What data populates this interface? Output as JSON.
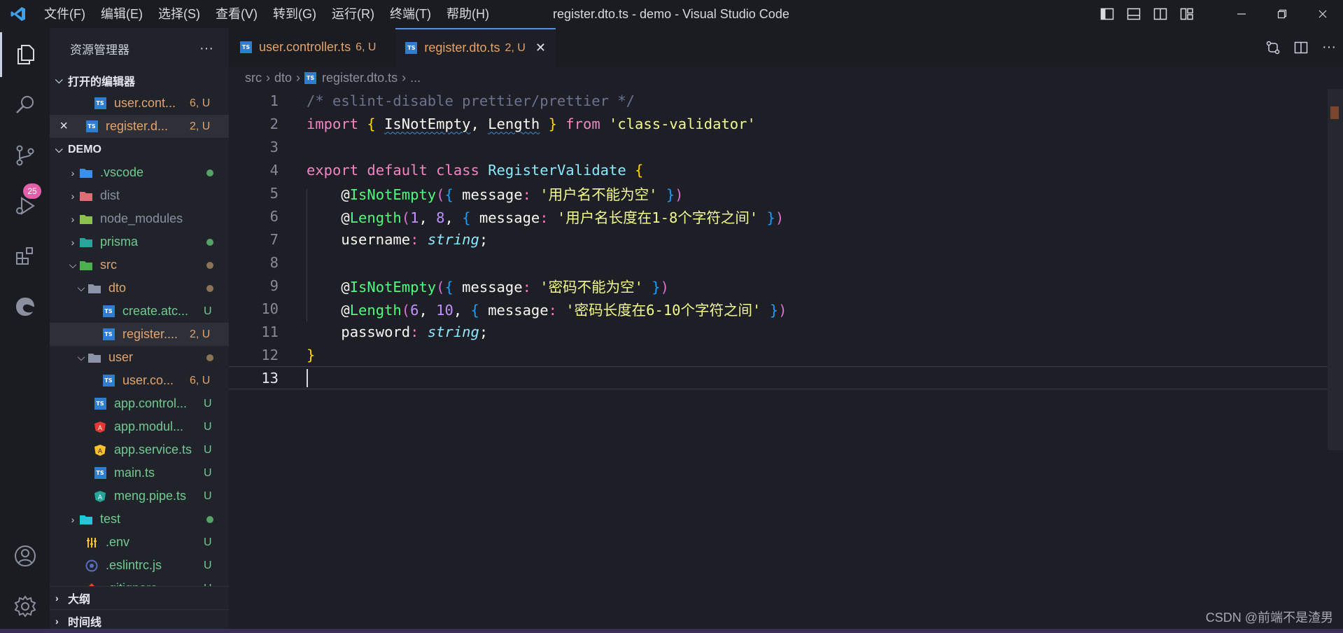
{
  "window": {
    "title": "register.dto.ts - demo - Visual Studio Code",
    "menu": [
      "文件(F)",
      "编辑(E)",
      "选择(S)",
      "查看(V)",
      "转到(G)",
      "运行(R)",
      "终端(T)",
      "帮助(H)"
    ]
  },
  "activity": {
    "scm_badge": "25"
  },
  "sidebar": {
    "title": "资源管理器",
    "more": "···",
    "open_editors_title": "打开的编辑器",
    "open_editors": [
      {
        "name": "user.cont...",
        "status": "6, U"
      },
      {
        "name": "register.d...",
        "status": "2, U"
      }
    ],
    "project_title": "DEMO",
    "tree": [
      {
        "name": ".vscode",
        "status": "",
        "kind": "folder"
      },
      {
        "name": "dist",
        "status": "",
        "kind": "folder"
      },
      {
        "name": "node_modules",
        "status": "",
        "kind": "folder"
      },
      {
        "name": "prisma",
        "status": "",
        "kind": "folder"
      },
      {
        "name": "src",
        "status": "",
        "kind": "folder"
      },
      {
        "name": "dto",
        "status": "",
        "kind": "folder"
      },
      {
        "name": "create.atc...",
        "status": "U",
        "kind": "ts"
      },
      {
        "name": "register....",
        "status": "2, U",
        "kind": "ts"
      },
      {
        "name": "user",
        "status": "",
        "kind": "folder"
      },
      {
        "name": "user.co...",
        "status": "6, U",
        "kind": "ts"
      },
      {
        "name": "app.control...",
        "status": "U",
        "kind": "ts"
      },
      {
        "name": "app.modul...",
        "status": "U",
        "kind": "angular"
      },
      {
        "name": "app.service.ts",
        "status": "U",
        "kind": "angular"
      },
      {
        "name": "main.ts",
        "status": "U",
        "kind": "ts"
      },
      {
        "name": "meng.pipe.ts",
        "status": "U",
        "kind": "angular"
      },
      {
        "name": "test",
        "status": "",
        "kind": "folder"
      },
      {
        "name": ".env",
        "status": "U",
        "kind": "env"
      },
      {
        "name": ".eslintrc.js",
        "status": "U",
        "kind": "eslint"
      },
      {
        "name": ".gitignore",
        "status": "U",
        "kind": "git"
      }
    ],
    "outline_title": "大纲",
    "timeline_title": "时间线"
  },
  "tabs": [
    {
      "name": "user.controller.ts",
      "status": "6, U"
    },
    {
      "name": "register.dto.ts",
      "status": "2, U"
    }
  ],
  "breadcrumb": [
    "src",
    "dto",
    "register.dto.ts",
    "..."
  ],
  "line_numbers": [
    "1",
    "2",
    "3",
    "4",
    "5",
    "6",
    "7",
    "8",
    "9",
    "10",
    "11",
    "12",
    "13"
  ],
  "code": {
    "l1": "/* eslint-disable prettier/prettier */",
    "l2_import": "import",
    "l2_ob": "{",
    "l2_a": "IsNotEmpty",
    "l2_comma": ",",
    "l2_b": "Length",
    "l2_cb": "}",
    "l2_from": "from",
    "l2_str": "'class-validator'",
    "l4_export": "export",
    "l4_default": "default",
    "l4_class": "class",
    "l4_name": "RegisterValidate",
    "l4_ob": "{",
    "at": "@",
    "dec_notempty": "IsNotEmpty",
    "dec_length": "Length",
    "message": "message",
    "l5_str": "'用户名不能为空'",
    "l6_n1": "1",
    "l6_n2": "8",
    "l6_str": "'用户名长度在1-8个字符之间'",
    "l7_prop": "username",
    "type_string": "string",
    "l9_str": "'密码不能为空'",
    "l10_n1": "6",
    "l10_n2": "10",
    "l10_str": "'密码长度在6-10个字符之间'",
    "l11_prop": "password",
    "l12_cb": "}"
  },
  "watermark": "CSDN @前端不是渣男"
}
